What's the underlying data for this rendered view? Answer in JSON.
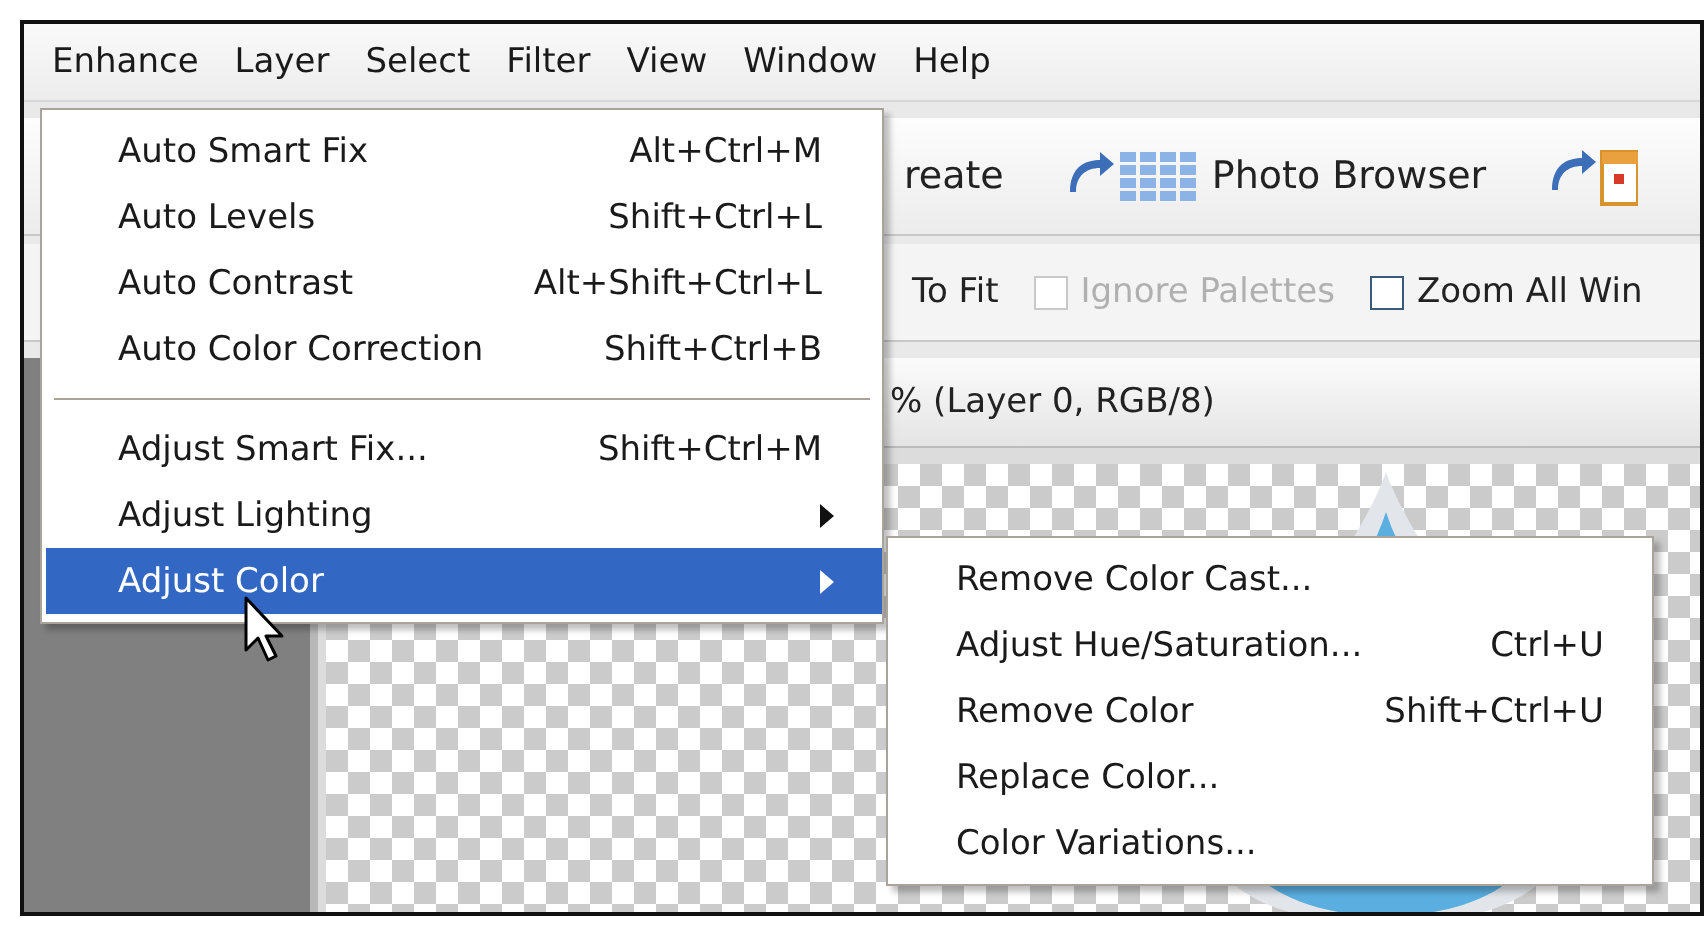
{
  "menubar": {
    "items": [
      "Enhance",
      "Layer",
      "Select",
      "Filter",
      "View",
      "Window",
      "Help"
    ]
  },
  "toolbar": {
    "buttons": [
      {
        "kind": "text",
        "label": "reate"
      },
      {
        "kind": "photo-browser",
        "label": "Photo Browser"
      },
      {
        "kind": "calendar"
      }
    ]
  },
  "options_bar": {
    "fit_label": "To Fit",
    "checkboxes": [
      {
        "label": "Ignore Palettes",
        "checked": false,
        "disabled": true
      },
      {
        "label": "Zoom All Win",
        "checked": false,
        "disabled": false
      }
    ]
  },
  "document": {
    "title": "% (Layer 0, RGB/8)"
  },
  "menu": {
    "items": [
      {
        "kind": "item",
        "label": "Auto Smart Fix",
        "shortcut": "Alt+Ctrl+M",
        "submenu": false,
        "selected": false
      },
      {
        "kind": "item",
        "label": "Auto Levels",
        "shortcut": "Shift+Ctrl+L",
        "submenu": false,
        "selected": false
      },
      {
        "kind": "item",
        "label": "Auto Contrast",
        "shortcut": "Alt+Shift+Ctrl+L",
        "submenu": false,
        "selected": false
      },
      {
        "kind": "item",
        "label": "Auto Color Correction",
        "shortcut": "Shift+Ctrl+B",
        "submenu": false,
        "selected": false
      },
      {
        "kind": "separator"
      },
      {
        "kind": "item",
        "label": "Adjust Smart Fix...",
        "shortcut": "Shift+Ctrl+M",
        "submenu": false,
        "selected": false
      },
      {
        "kind": "item",
        "label": "Adjust Lighting",
        "submenu": true,
        "selected": false
      },
      {
        "kind": "item",
        "label": "Adjust Color",
        "submenu": true,
        "selected": true
      }
    ]
  },
  "submenu": {
    "items": [
      {
        "label": "Remove Color Cast..."
      },
      {
        "label": "Adjust Hue/Saturation...",
        "shortcut": "Ctrl+U"
      },
      {
        "label": "Remove Color",
        "shortcut": "Shift+Ctrl+U"
      },
      {
        "label": "Replace Color..."
      },
      {
        "label": "Color Variations..."
      }
    ]
  }
}
